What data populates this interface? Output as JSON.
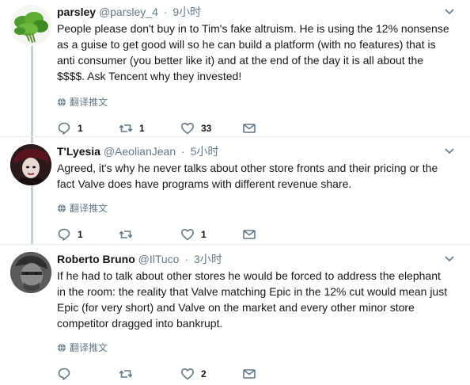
{
  "tweets": [
    {
      "display_name": "parsley",
      "handle": "@parsley_4",
      "time": "9小时",
      "text": "People please don't buy in to Tim's fake altruism. He is using the 12% nonsense\nas a guise to get good will so he can build a platform (with no features) that is\nanti consumer (you better like it) and at the end of the day it is all about the\n$$$$. Ask Tencent why they invested!",
      "translate_label": "翻译推文",
      "reply_count": "1",
      "retweet_count": "1",
      "like_count": "33"
    },
    {
      "display_name": "T'Lyesia",
      "handle": "@AeolianJean",
      "time": "5小时",
      "text": "Agreed, it's why he never talks about other store fronts and their pricing or the\nfact Valve does have programs with different revenue share.",
      "translate_label": "翻译推文",
      "reply_count": "1",
      "retweet_count": "",
      "like_count": "1"
    },
    {
      "display_name": "Roberto Bruno",
      "handle": "@IlTuco",
      "time": "3小时",
      "text": "If he had to talk about other stores he would be forced to address the elephant\nin the room: the reality that Valve matching Epic in the 12% cut would mean just\nEpic (for very short) and Valve on the market and every other minor store\ncompetitor dragged into bankrupt.",
      "translate_label": "翻译推文",
      "reply_count": "",
      "retweet_count": "",
      "like_count": "2"
    }
  ],
  "colors": {
    "text": "#14171a",
    "secondary": "#657786",
    "thread_line": "#c4cfd6",
    "divider": "#e6ecf0"
  }
}
